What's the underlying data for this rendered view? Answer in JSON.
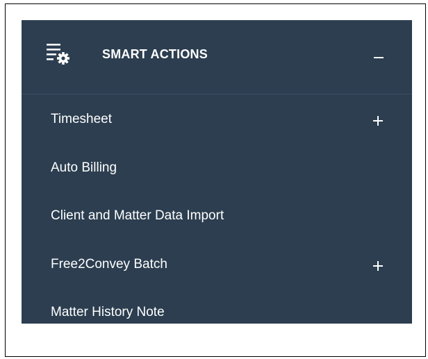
{
  "panel": {
    "title": "SMART ACTIONS",
    "header_icon": "list-settings-icon",
    "collapse_icon": "minus-icon",
    "background_color": "#2c3e50",
    "text_color": "#ffffff",
    "items": [
      {
        "label": "Timesheet",
        "has_submenu": true,
        "icon": "plus-icon"
      },
      {
        "label": "Auto Billing",
        "has_submenu": false
      },
      {
        "label": "Client and Matter Data Import",
        "has_submenu": false
      },
      {
        "label": "Free2Convey Batch",
        "has_submenu": true,
        "icon": "plus-icon"
      },
      {
        "label": "Matter History Note",
        "has_submenu": false
      }
    ]
  }
}
